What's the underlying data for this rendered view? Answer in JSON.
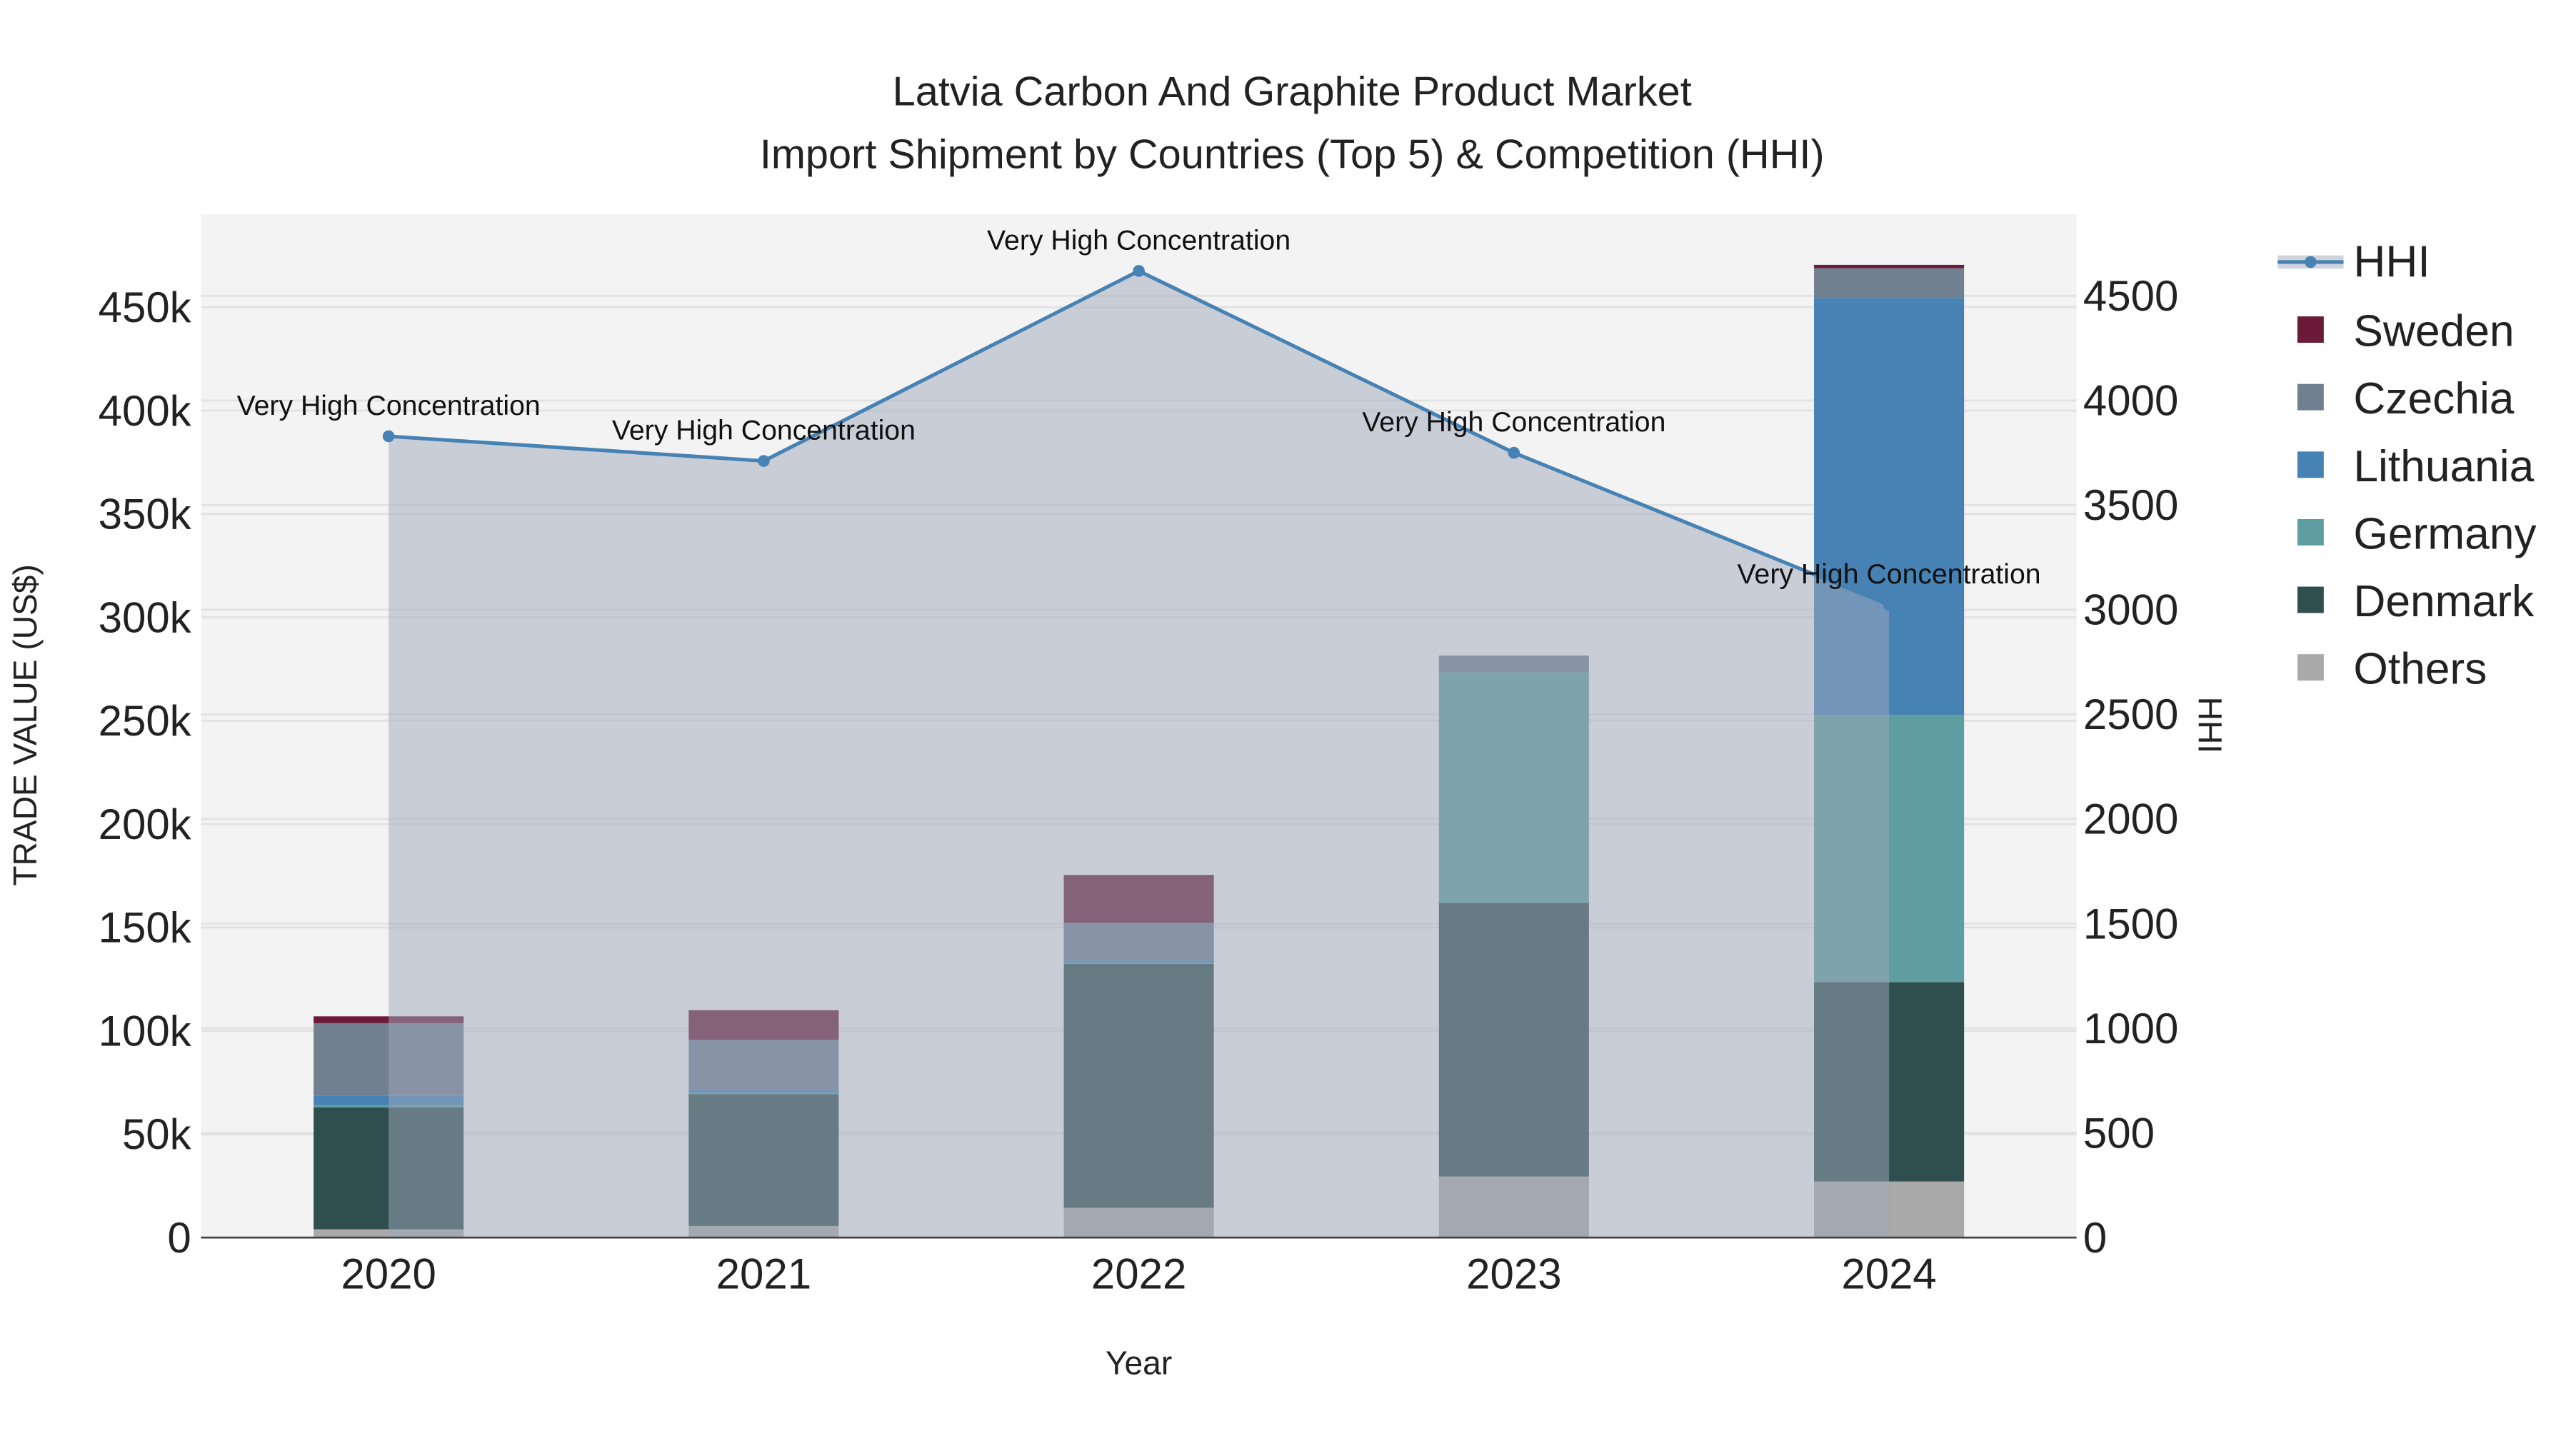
{
  "chart_data": {
    "type": "bar",
    "title": "Latvia Carbon And Graphite Product Market",
    "subtitle": "Import Shipment by Countries (Top 5) & Competition (HHI)",
    "xlabel": "Year",
    "ylabel": "TRADE VALUE (US$)",
    "y2label": "HHI",
    "categories": [
      "2020",
      "2021",
      "2022",
      "2023",
      "2024"
    ],
    "ylim": [
      0,
      495000
    ],
    "y2lim": [
      0,
      4890
    ],
    "yticks": [
      0,
      50000,
      100000,
      150000,
      200000,
      250000,
      300000,
      350000,
      400000,
      450000
    ],
    "ytick_labels": [
      "0",
      "50k",
      "100k",
      "150k",
      "200k",
      "250k",
      "300k",
      "350k",
      "400k",
      "450k"
    ],
    "y2ticks": [
      0,
      500,
      1000,
      1500,
      2000,
      2500,
      3000,
      3500,
      4000,
      4500
    ],
    "y2tick_labels": [
      "0",
      "500",
      "1000",
      "1500",
      "2000",
      "2500",
      "3000",
      "3500",
      "4000",
      "4500"
    ],
    "stacked": true,
    "grid": true,
    "legend_position": "right",
    "series": [
      {
        "name": "Others",
        "color": "#a9a9a9",
        "values": [
          4000,
          5600,
          14400,
          29500,
          27100
        ]
      },
      {
        "name": "Denmark",
        "color": "#2f4f4f",
        "values": [
          59000,
          63800,
          118000,
          132400,
          96500
        ]
      },
      {
        "name": "Germany",
        "color": "#5f9ea0",
        "values": [
          1000,
          500,
          300,
          111600,
          129200
        ]
      },
      {
        "name": "Lithuania",
        "color": "#4682b4",
        "values": [
          4500,
          1900,
          1300,
          0,
          201700
        ]
      },
      {
        "name": "Czechia",
        "color": "#708090",
        "values": [
          35200,
          23900,
          18300,
          8000,
          14400
        ]
      },
      {
        "name": "Sweden",
        "color": "#6b1a3a",
        "values": [
          3300,
          14300,
          23100,
          0,
          1600
        ]
      }
    ],
    "hhi": {
      "name": "HHI",
      "color": "#4682b4",
      "values": [
        3829,
        3711,
        4619,
        3750,
        3024
      ],
      "annotations": [
        "Very High Concentration",
        "Very High Concentration",
        "Very High Concentration",
        "Very High Concentration",
        "Very High Concentration"
      ]
    },
    "legend_order": [
      "HHI",
      "Sweden",
      "Czechia",
      "Lithuania",
      "Germany",
      "Denmark",
      "Others"
    ]
  }
}
